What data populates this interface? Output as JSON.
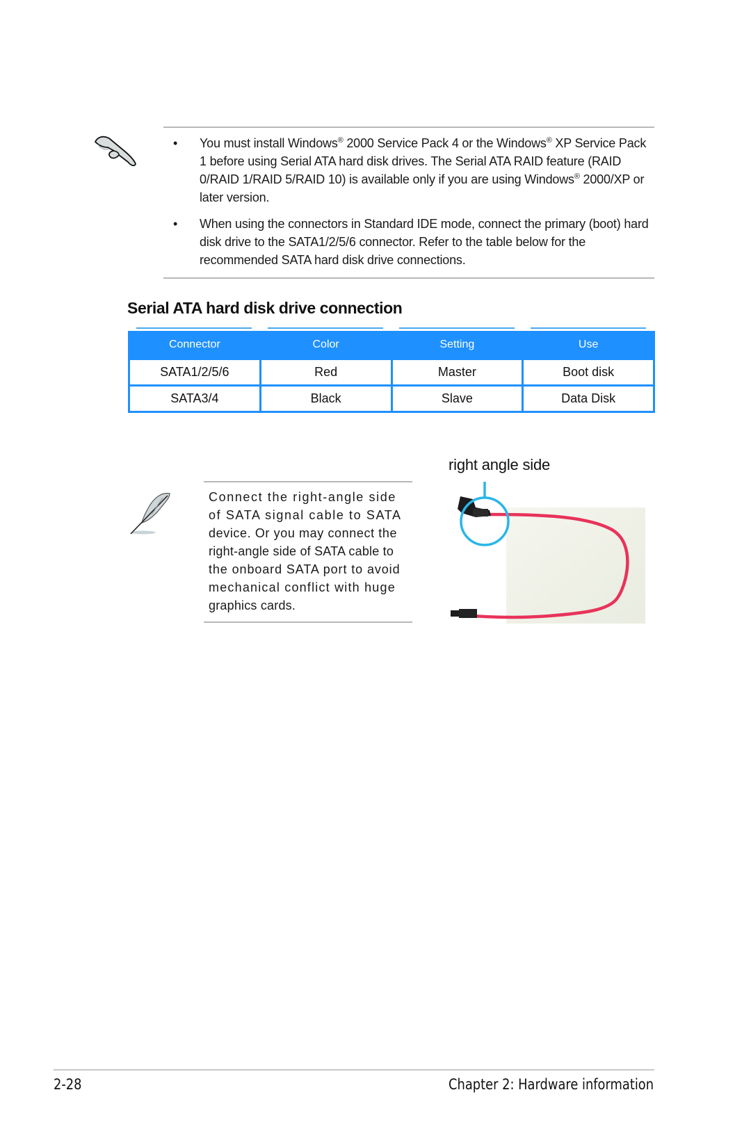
{
  "notes": {
    "icon": "pointing-hand-icon",
    "items": [
      {
        "parts": [
          "You must install Windows",
          "®",
          " 2000 Service Pack 4 or the Windows",
          "®",
          " XP Service Pack 1 before using Serial ATA hard disk drives. The Serial ATA RAID feature (RAID 0/RAID 1/RAID 5/RAID 10) is available only if you are using Windows",
          "®",
          " 2000/XP or later version."
        ]
      },
      {
        "text": "When using the connectors in Standard IDE mode, connect the primary (boot) hard disk drive to the SATA1/2/5/6 connector. Refer to the table below for the recommended SATA hard disk drive connections."
      }
    ],
    "bullet": "•"
  },
  "section": {
    "heading": "Serial ATA hard disk drive connection"
  },
  "table": {
    "header_color": "#1e90ff",
    "columns": [
      "Connector",
      "Color",
      "Setting",
      "Use"
    ],
    "rows": [
      [
        "SATA1/2/5/6",
        "Red",
        "Master",
        "Boot disk"
      ],
      [
        "SATA3/4",
        "Black",
        "Slave",
        "Data Disk"
      ]
    ]
  },
  "tip": {
    "icon": "feather-icon",
    "lines": [
      "Connect the right-angle side",
      "of SATA signal cable to SATA",
      "device. Or you may connect the",
      "right-angle side of SATA cable to",
      "the onboard SATA port to avoid",
      "mechanical conflict with huge",
      "graphics cards."
    ]
  },
  "photo": {
    "label": "right angle side",
    "callout_color": "#29b6e8",
    "cable_color": "#e8335a"
  },
  "footer": {
    "page_number": "2-28",
    "chapter": "Chapter 2: Hardware information"
  }
}
